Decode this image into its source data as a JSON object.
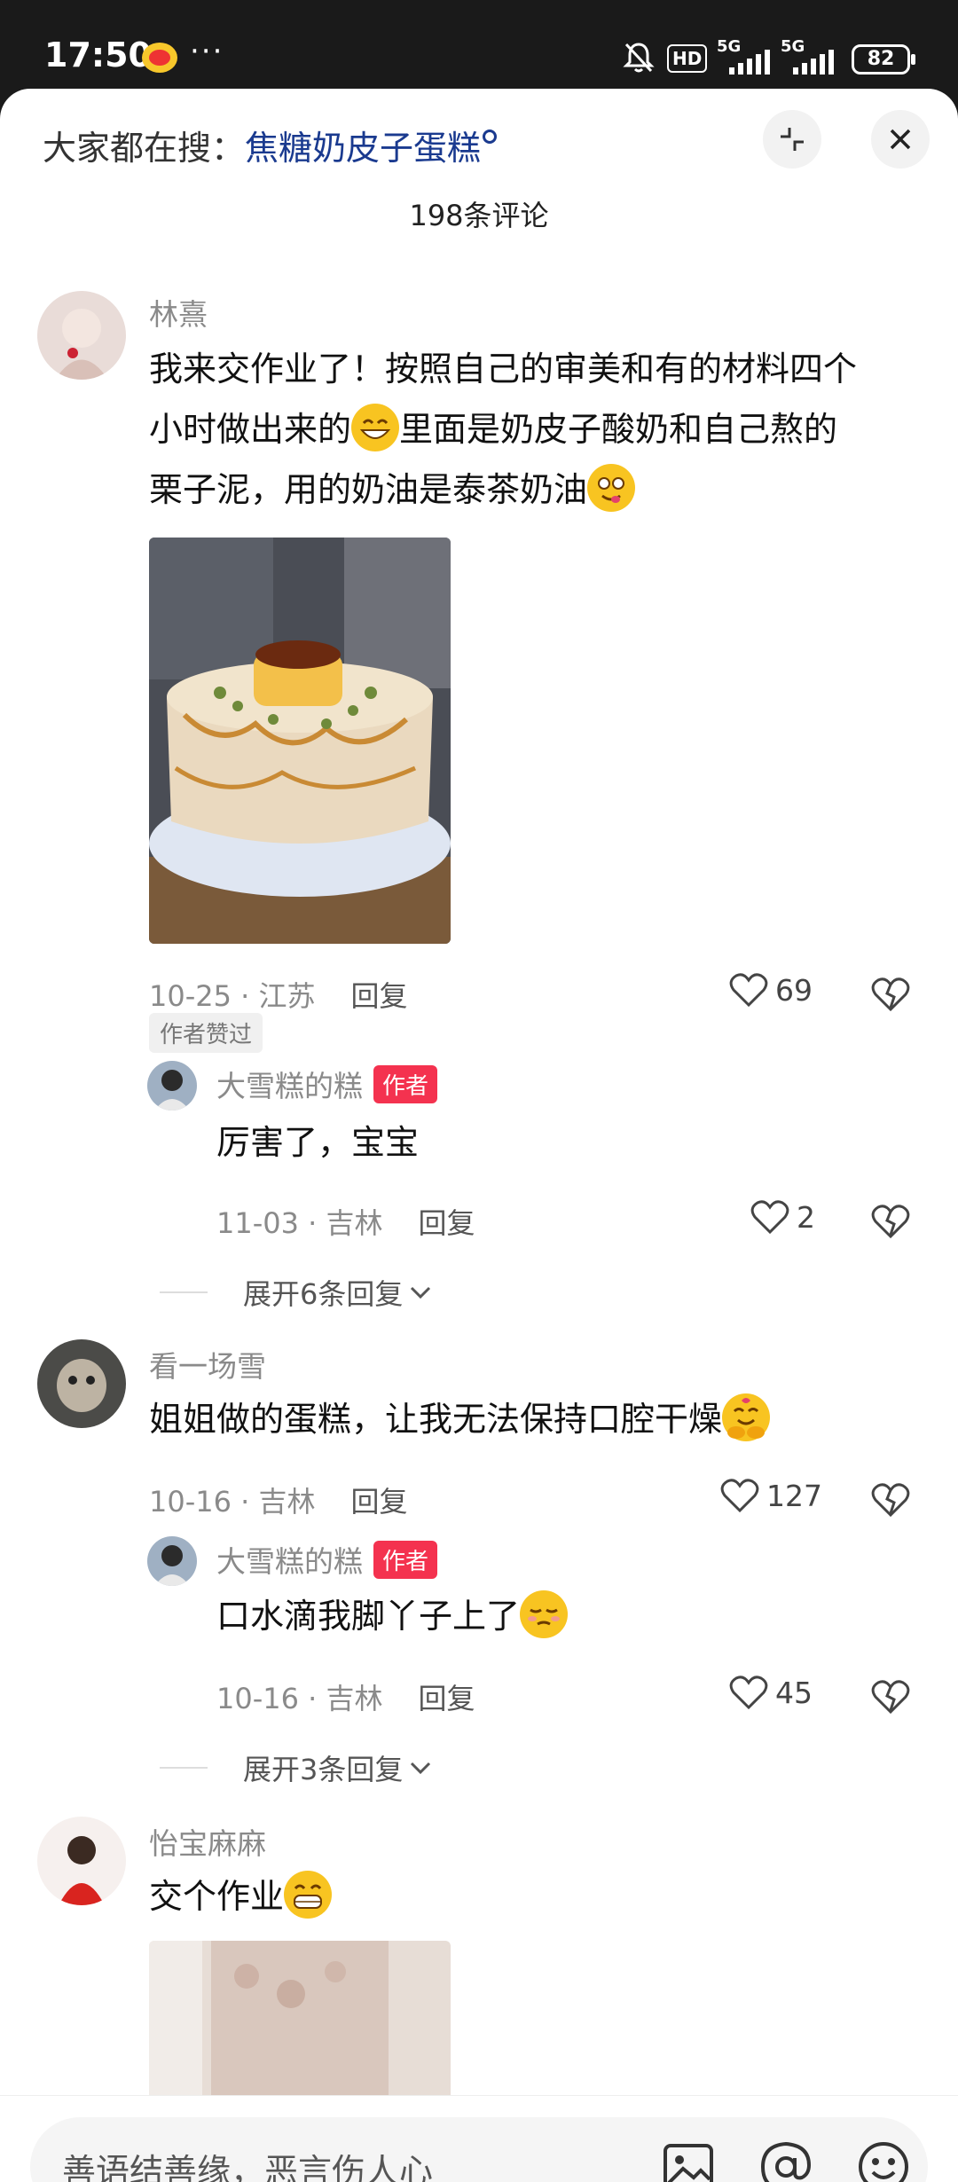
{
  "status_bar": {
    "time": "17:50",
    "dots": "···",
    "hd": "HD",
    "net1": "5G",
    "net2": "5G",
    "battery": "82"
  },
  "header": {
    "search_prefix": "大家都在搜：",
    "search_keyword": "焦糖奶皮子蛋糕",
    "comment_count": "198条评论"
  },
  "comments": [
    {
      "user": "林熹",
      "text_line1": "我来交作业了！按照自己的审美和有的材料四个",
      "text_line2": "小时做出来的",
      "text_line2b": "里面是奶皮子酸奶和自己熬的",
      "text_line3": "栗子泥，用的奶油是泰茶奶油",
      "meta": "10-25 · 江苏",
      "reply": "回复",
      "likes": "69",
      "tag": "作者赞过",
      "sub": {
        "user": "大雪糕的糕",
        "badge": "作者",
        "text": "厉害了，宝宝",
        "meta": "11-03 · 吉林",
        "reply": "回复",
        "likes": "2"
      },
      "expand": "展开6条回复"
    },
    {
      "user": "看一场雪",
      "text": "姐姐做的蛋糕，让我无法保持口腔干燥",
      "meta": "10-16 · 吉林",
      "reply": "回复",
      "likes": "127",
      "sub": {
        "user": "大雪糕的糕",
        "badge": "作者",
        "text": "口水滴我脚丫子上了",
        "meta": "10-16 · 吉林",
        "reply": "回复",
        "likes": "45"
      },
      "expand": "展开3条回复"
    },
    {
      "user": "怡宝麻麻",
      "text": "交个作业"
    }
  ],
  "input": {
    "placeholder": "善语结善缘，恶言伤人心"
  },
  "colors": {
    "accent": "#f4324f",
    "keyword": "#1a3a8f"
  }
}
